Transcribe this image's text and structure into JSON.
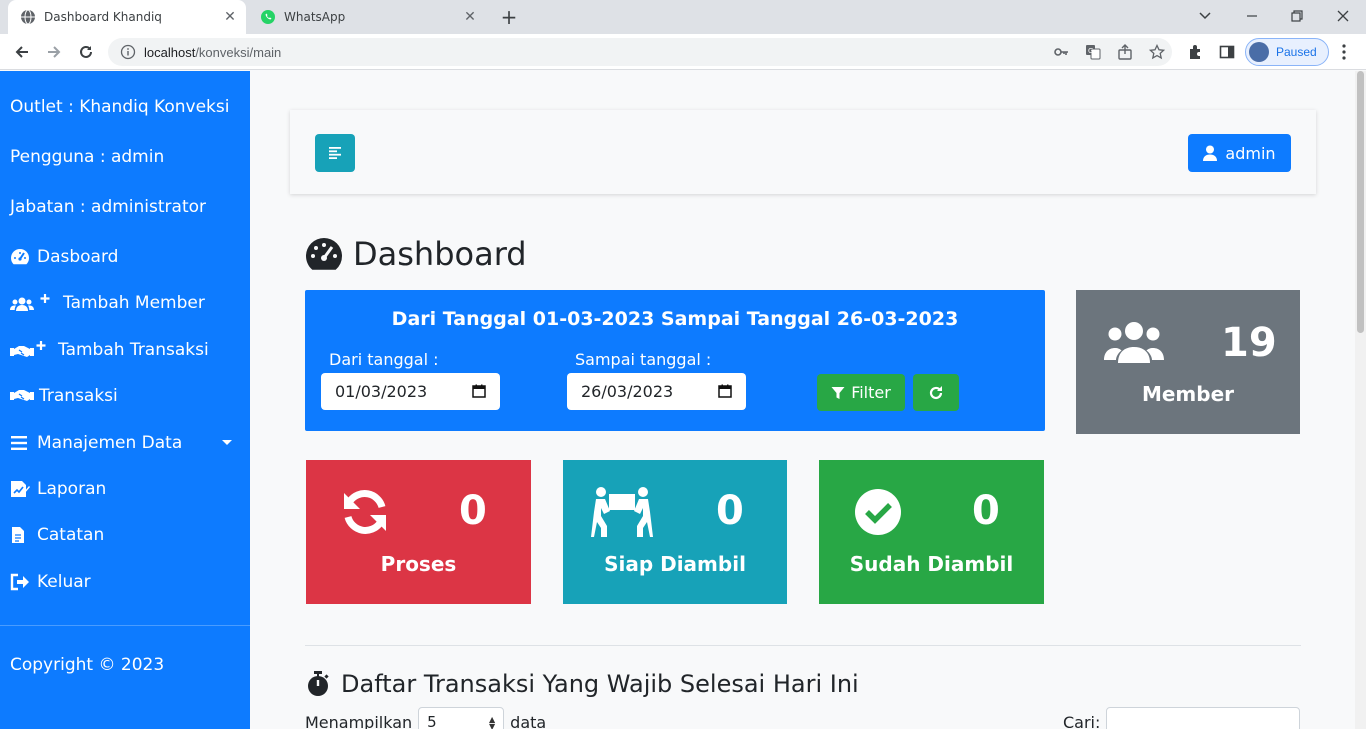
{
  "browser": {
    "tabs": [
      {
        "title": "Dashboard Khandiq",
        "icon": "globe-icon",
        "active": true
      },
      {
        "title": "WhatsApp",
        "icon": "whatsapp-icon",
        "active": false
      }
    ],
    "url_host": "localhost",
    "url_path": "/konveksi/main",
    "profile_status": "Paused"
  },
  "sidebar": {
    "outlet": "Outlet : Khandiq Konveksi",
    "user": "Pengguna : admin",
    "role": "Jabatan : administrator",
    "items": [
      {
        "label": "Dasboard",
        "icon": "tachometer-icon"
      },
      {
        "label": "Tambah Member",
        "icon": "users-plus-icon"
      },
      {
        "label": "Tambah Transaksi",
        "icon": "handshake-plus-icon"
      },
      {
        "label": "Transaksi",
        "icon": "handshake-icon"
      },
      {
        "label": "Manajemen Data",
        "icon": "bars-icon"
      },
      {
        "label": "Laporan",
        "icon": "report-icon"
      },
      {
        "label": "Catatan",
        "icon": "file-icon"
      },
      {
        "label": "Keluar",
        "icon": "sign-out-icon"
      }
    ],
    "copyright": "Copyright © 2023"
  },
  "header": {
    "user_button": "admin"
  },
  "main": {
    "title": "Dashboard",
    "filter": {
      "heading": "Dari Tanggal 01-03-2023 Sampai Tanggal 26-03-2023",
      "from_label": "Dari tanggal :",
      "from_value": "01/03/2023",
      "to_label": "Sampai tanggal :",
      "to_value": "26/03/2023",
      "filter_button": "Filter"
    },
    "stats": [
      {
        "label": "Member",
        "value": "19",
        "color": "#6c757d",
        "icon": "users-icon"
      },
      {
        "label": "Proses",
        "value": "0",
        "color": "#dc3545",
        "icon": "sync-icon"
      },
      {
        "label": "Siap Diambil",
        "value": "0",
        "color": "#17a2b8",
        "icon": "people-carry-icon"
      },
      {
        "label": "Sudah Diambil",
        "value": "0",
        "color": "#28a745",
        "icon": "check-circle-icon"
      }
    ],
    "section_title": "Daftar Transaksi Yang Wajib Selesai Hari Ini",
    "table_length": {
      "prefix": "Menampilkan",
      "value": "5",
      "suffix": "data"
    },
    "search_label": "Cari:"
  },
  "colors": {
    "primary": "#0d7bff",
    "info": "#17a2b8",
    "success": "#28a745",
    "danger": "#dc3545",
    "secondary": "#6c757d"
  }
}
